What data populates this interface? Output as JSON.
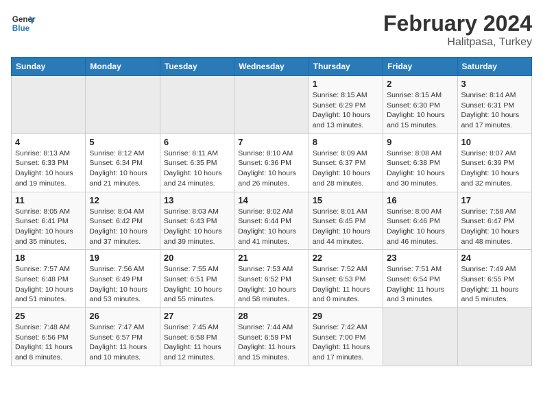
{
  "logo": {
    "line1": "General",
    "line2": "Blue"
  },
  "title": "February 2024",
  "subtitle": "Halitpasa, Turkey",
  "weekdays": [
    "Sunday",
    "Monday",
    "Tuesday",
    "Wednesday",
    "Thursday",
    "Friday",
    "Saturday"
  ],
  "weeks": [
    [
      {
        "day": "",
        "info": ""
      },
      {
        "day": "",
        "info": ""
      },
      {
        "day": "",
        "info": ""
      },
      {
        "day": "",
        "info": ""
      },
      {
        "day": "1",
        "info": "Sunrise: 8:15 AM\nSunset: 6:29 PM\nDaylight: 10 hours\nand 13 minutes."
      },
      {
        "day": "2",
        "info": "Sunrise: 8:15 AM\nSunset: 6:30 PM\nDaylight: 10 hours\nand 15 minutes."
      },
      {
        "day": "3",
        "info": "Sunrise: 8:14 AM\nSunset: 6:31 PM\nDaylight: 10 hours\nand 17 minutes."
      }
    ],
    [
      {
        "day": "4",
        "info": "Sunrise: 8:13 AM\nSunset: 6:33 PM\nDaylight: 10 hours\nand 19 minutes."
      },
      {
        "day": "5",
        "info": "Sunrise: 8:12 AM\nSunset: 6:34 PM\nDaylight: 10 hours\nand 21 minutes."
      },
      {
        "day": "6",
        "info": "Sunrise: 8:11 AM\nSunset: 6:35 PM\nDaylight: 10 hours\nand 24 minutes."
      },
      {
        "day": "7",
        "info": "Sunrise: 8:10 AM\nSunset: 6:36 PM\nDaylight: 10 hours\nand 26 minutes."
      },
      {
        "day": "8",
        "info": "Sunrise: 8:09 AM\nSunset: 6:37 PM\nDaylight: 10 hours\nand 28 minutes."
      },
      {
        "day": "9",
        "info": "Sunrise: 8:08 AM\nSunset: 6:38 PM\nDaylight: 10 hours\nand 30 minutes."
      },
      {
        "day": "10",
        "info": "Sunrise: 8:07 AM\nSunset: 6:39 PM\nDaylight: 10 hours\nand 32 minutes."
      }
    ],
    [
      {
        "day": "11",
        "info": "Sunrise: 8:05 AM\nSunset: 6:41 PM\nDaylight: 10 hours\nand 35 minutes."
      },
      {
        "day": "12",
        "info": "Sunrise: 8:04 AM\nSunset: 6:42 PM\nDaylight: 10 hours\nand 37 minutes."
      },
      {
        "day": "13",
        "info": "Sunrise: 8:03 AM\nSunset: 6:43 PM\nDaylight: 10 hours\nand 39 minutes."
      },
      {
        "day": "14",
        "info": "Sunrise: 8:02 AM\nSunset: 6:44 PM\nDaylight: 10 hours\nand 41 minutes."
      },
      {
        "day": "15",
        "info": "Sunrise: 8:01 AM\nSunset: 6:45 PM\nDaylight: 10 hours\nand 44 minutes."
      },
      {
        "day": "16",
        "info": "Sunrise: 8:00 AM\nSunset: 6:46 PM\nDaylight: 10 hours\nand 46 minutes."
      },
      {
        "day": "17",
        "info": "Sunrise: 7:58 AM\nSunset: 6:47 PM\nDaylight: 10 hours\nand 48 minutes."
      }
    ],
    [
      {
        "day": "18",
        "info": "Sunrise: 7:57 AM\nSunset: 6:48 PM\nDaylight: 10 hours\nand 51 minutes."
      },
      {
        "day": "19",
        "info": "Sunrise: 7:56 AM\nSunset: 6:49 PM\nDaylight: 10 hours\nand 53 minutes."
      },
      {
        "day": "20",
        "info": "Sunrise: 7:55 AM\nSunset: 6:51 PM\nDaylight: 10 hours\nand 55 minutes."
      },
      {
        "day": "21",
        "info": "Sunrise: 7:53 AM\nSunset: 6:52 PM\nDaylight: 10 hours\nand 58 minutes."
      },
      {
        "day": "22",
        "info": "Sunrise: 7:52 AM\nSunset: 6:53 PM\nDaylight: 11 hours\nand 0 minutes."
      },
      {
        "day": "23",
        "info": "Sunrise: 7:51 AM\nSunset: 6:54 PM\nDaylight: 11 hours\nand 3 minutes."
      },
      {
        "day": "24",
        "info": "Sunrise: 7:49 AM\nSunset: 6:55 PM\nDaylight: 11 hours\nand 5 minutes."
      }
    ],
    [
      {
        "day": "25",
        "info": "Sunrise: 7:48 AM\nSunset: 6:56 PM\nDaylight: 11 hours\nand 8 minutes."
      },
      {
        "day": "26",
        "info": "Sunrise: 7:47 AM\nSunset: 6:57 PM\nDaylight: 11 hours\nand 10 minutes."
      },
      {
        "day": "27",
        "info": "Sunrise: 7:45 AM\nSunset: 6:58 PM\nDaylight: 11 hours\nand 12 minutes."
      },
      {
        "day": "28",
        "info": "Sunrise: 7:44 AM\nSunset: 6:59 PM\nDaylight: 11 hours\nand 15 minutes."
      },
      {
        "day": "29",
        "info": "Sunrise: 7:42 AM\nSunset: 7:00 PM\nDaylight: 11 hours\nand 17 minutes."
      },
      {
        "day": "",
        "info": ""
      },
      {
        "day": "",
        "info": ""
      }
    ]
  ]
}
